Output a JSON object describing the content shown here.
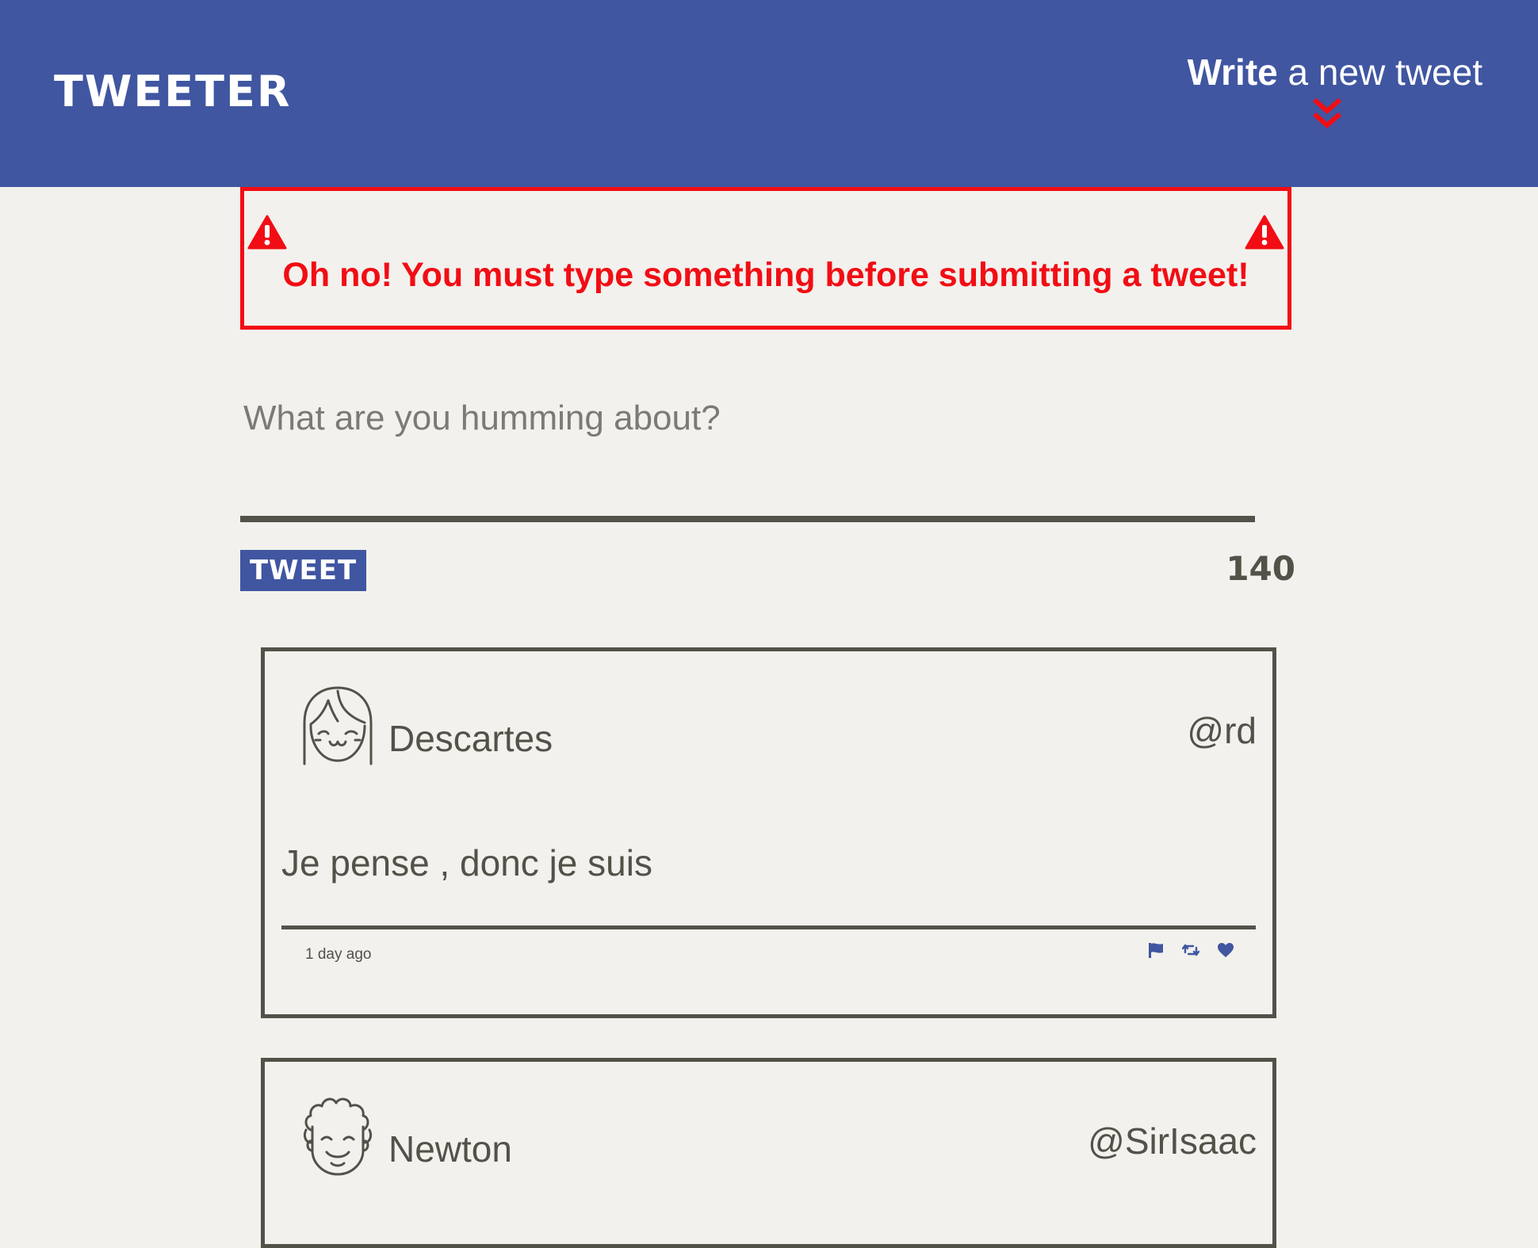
{
  "nav": {
    "brand": "Tweeter",
    "compose_toggle": {
      "strong": "Write",
      "rest": " a new tweet"
    }
  },
  "error": {
    "message": "Oh no! You must type something before submitting a tweet!"
  },
  "compose": {
    "placeholder": "What are you humming about?",
    "value": "",
    "submit_label": "Tweet",
    "counter": "140"
  },
  "tweets": [
    {
      "author": "Descartes",
      "handle": "@rd",
      "content": "Je pense , donc je suis",
      "time": "1 day ago"
    },
    {
      "author": "Newton",
      "handle": "@SirIsaac"
    }
  ],
  "colors": {
    "primary": "#4056a1",
    "background": "#f2f1ed",
    "text": "#545149",
    "error": "#f20d14",
    "white": "#ffffff"
  },
  "icons": {
    "toggle": "double-chevron-down-icon",
    "warning": "warning-triangle-icon",
    "actions": [
      "flag-icon",
      "retweet-icon",
      "heart-icon"
    ]
  }
}
